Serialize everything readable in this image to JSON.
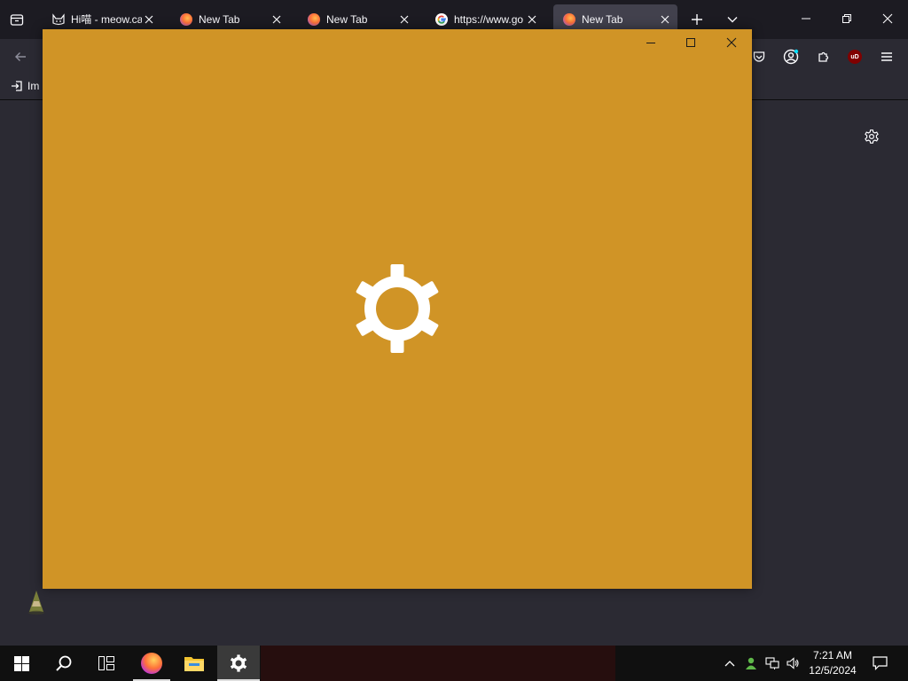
{
  "browser": {
    "tabs": [
      {
        "title": "Hi喵 - meow.ca",
        "favicon": "cat-icon",
        "active": false
      },
      {
        "title": "New Tab",
        "favicon": "firefox-icon",
        "active": false
      },
      {
        "title": "New Tab",
        "favicon": "firefox-icon",
        "active": false
      },
      {
        "title": "https://www.go",
        "favicon": "google-icon",
        "active": false
      },
      {
        "title": "New Tab",
        "favicon": "firefox-icon",
        "active": true
      }
    ],
    "bookmarks": {
      "import_label": "Im"
    },
    "extension_badge": "uD"
  },
  "app_window": {
    "background_color": "#d09426",
    "splash_icon": "gear-icon"
  },
  "taskbar": {
    "time": "7:21 AM",
    "date": "12/5/2024",
    "pinned": [
      "start-icon",
      "search-icon",
      "task-view-icon",
      "firefox-icon",
      "file-explorer-icon",
      "settings-icon"
    ]
  },
  "colors": {
    "accent": "#d09426",
    "browser_frame": "#1c1b22",
    "browser_toolbar": "#2b2a33",
    "taskbar": "#101010"
  }
}
